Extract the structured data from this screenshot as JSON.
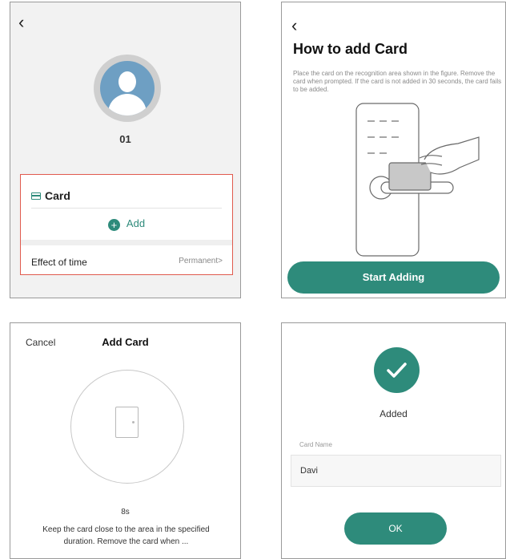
{
  "panel1": {
    "back_icon": "chevron-left",
    "user_name": "01",
    "card_title": "Card",
    "add_label": "Add",
    "effect_label": "Effect of time",
    "effect_value": "Permanent>",
    "accent": "#2e8b7b",
    "highlight": "#e05a4e"
  },
  "panel2": {
    "back_icon": "chevron-left",
    "title": "How to add Card",
    "description": "Place the card on the recognition area shown in the figure. Remove the card when prompted. If the card is not added in 30 seconds, the card fails to be added.",
    "button": "Start Adding"
  },
  "panel3": {
    "cancel": "Cancel",
    "title": "Add Card",
    "timer": "8s",
    "instruction": "Keep the card close to the area in the specified duration. Remove the card when ..."
  },
  "panel4": {
    "status": "Added",
    "name_label": "Card Name",
    "name_value": "Davi",
    "ok_button": "OK"
  }
}
